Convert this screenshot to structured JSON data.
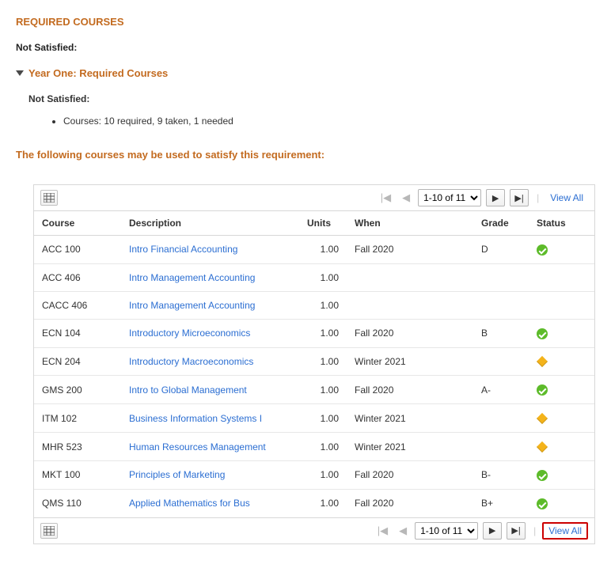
{
  "header": {
    "title": "REQUIRED COURSES",
    "not_satisfied": "Not Satisfied:",
    "year_label": "Year One: Required Courses",
    "inner_not_satisfied": "Not Satisfied:",
    "bullet": "Courses: 10 required, 9 taken, 1 needed",
    "following": "The following courses may be used to satisfy this requirement:"
  },
  "pager": {
    "range": "1-10 of 11",
    "view_all": "View All"
  },
  "columns": {
    "course": "Course",
    "description": "Description",
    "units": "Units",
    "when": "When",
    "grade": "Grade",
    "status": "Status"
  },
  "rows": [
    {
      "course": "ACC 100",
      "desc": "Intro Financial Accounting",
      "units": "1.00",
      "when": "Fall 2020",
      "grade": "D",
      "status": "check"
    },
    {
      "course": "ACC 406",
      "desc": "Intro Management Accounting",
      "units": "1.00",
      "when": "",
      "grade": "",
      "status": ""
    },
    {
      "course": "CACC 406",
      "desc": "Intro Management Accounting",
      "units": "1.00",
      "when": "",
      "grade": "",
      "status": ""
    },
    {
      "course": "ECN 104",
      "desc": "Introductory Microeconomics",
      "units": "1.00",
      "when": "Fall 2020",
      "grade": "B",
      "status": "check"
    },
    {
      "course": "ECN 204",
      "desc": "Introductory Macroeconomics",
      "units": "1.00",
      "when": "Winter 2021",
      "grade": "",
      "status": "diamond"
    },
    {
      "course": "GMS 200",
      "desc": "Intro to Global Management",
      "units": "1.00",
      "when": "Fall 2020",
      "grade": "A-",
      "status": "check"
    },
    {
      "course": "ITM 102",
      "desc": "Business Information Systems I",
      "units": "1.00",
      "when": "Winter 2021",
      "grade": "",
      "status": "diamond"
    },
    {
      "course": "MHR 523",
      "desc": "Human Resources Management",
      "units": "1.00",
      "when": "Winter 2021",
      "grade": "",
      "status": "diamond"
    },
    {
      "course": "MKT 100",
      "desc": "Principles of Marketing",
      "units": "1.00",
      "when": "Fall 2020",
      "grade": "B-",
      "status": "check"
    },
    {
      "course": "QMS 110",
      "desc": "Applied Mathematics for Bus",
      "units": "1.00",
      "when": "Fall 2020",
      "grade": "B+",
      "status": "check"
    }
  ]
}
